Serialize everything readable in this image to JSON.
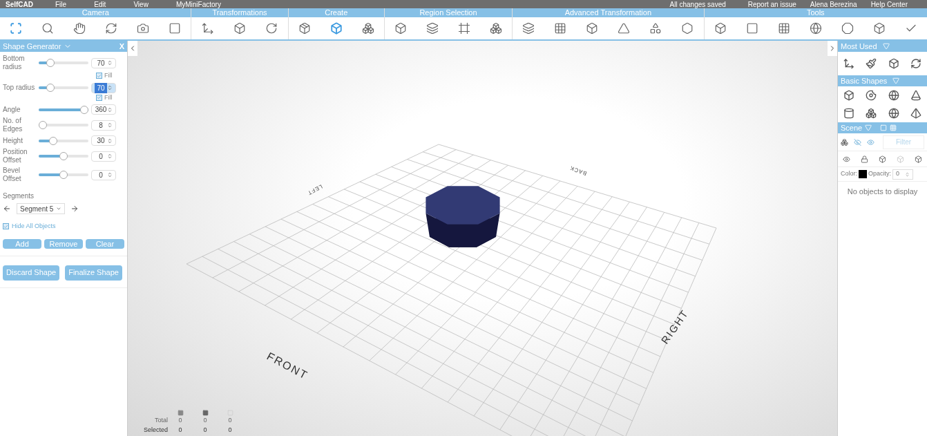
{
  "menu_bar": {
    "logo": "SelfCAD",
    "menus": [
      "File",
      "Edit",
      "View",
      "MyMiniFactory"
    ],
    "status": "All changes saved",
    "links": [
      "Report an issue",
      "Alena Berezina",
      "Help Center"
    ]
  },
  "toolbar": {
    "groups": [
      {
        "label": "Camera",
        "tools": [
          {
            "selected": true
          },
          {
            "selected": false
          },
          {
            "selected": false
          },
          {
            "selected": false
          },
          {
            "selected": false
          },
          {
            "selected": false
          }
        ]
      },
      {
        "label": "Transformations",
        "tools": [
          {
            "selected": false
          },
          {
            "selected": false
          },
          {
            "selected": false
          }
        ]
      },
      {
        "label": "Create",
        "tools": [
          {
            "selected": false
          },
          {
            "selected": true
          },
          {
            "selected": false
          }
        ]
      },
      {
        "label": "Region Selection",
        "tools": [
          {
            "selected": false
          },
          {
            "selected": false
          },
          {
            "selected": false
          },
          {
            "selected": false
          }
        ]
      },
      {
        "label": "Advanced Transformation",
        "tools": [
          {
            "selected": false
          },
          {
            "selected": false
          },
          {
            "selected": false
          },
          {
            "selected": false
          },
          {
            "selected": false
          },
          {
            "selected": false
          }
        ]
      },
      {
        "label": "Tools",
        "tools": [
          {
            "selected": false
          },
          {
            "selected": false
          },
          {
            "selected": false
          },
          {
            "selected": false
          },
          {
            "selected": false
          },
          {
            "selected": false
          },
          {
            "selected": false
          }
        ]
      }
    ]
  },
  "shape_generator": {
    "title": "Shape Generator",
    "close": "X",
    "params": [
      {
        "label": "Bottom radius",
        "level": 0.18,
        "value": "70",
        "fill": {
          "label": "Fill",
          "checked": true
        },
        "highlighted": false
      },
      {
        "label": "Top radius",
        "level": 0.18,
        "value": "70",
        "fill": {
          "label": "Fill",
          "checked": true
        },
        "highlighted": true
      },
      {
        "label": "Angle",
        "level": 1.0,
        "value": "360",
        "highlighted": false
      },
      {
        "label": "No. of Edges",
        "level": 0.0,
        "value": "8",
        "highlighted": false
      },
      {
        "label": "Height",
        "level": 0.25,
        "value": "30",
        "highlighted": false
      },
      {
        "label": "Position Offset",
        "level": 0.5,
        "value": "0",
        "highlighted": false
      },
      {
        "label": "Bevel Offset",
        "level": 0.5,
        "value": "0",
        "highlighted": false
      }
    ],
    "segments": {
      "label": "Segments",
      "value": "Segment 5"
    },
    "hide_all": {
      "label": "Hide All Objects",
      "checked": true
    },
    "buttons": [
      "Add",
      "Remove",
      "Clear"
    ],
    "actions": [
      "Discard Shape",
      "Finalize Shape"
    ]
  },
  "viewport": {
    "labels": {
      "front": "FRONT",
      "right": "RIGHT",
      "left": "LEFT",
      "back": "BACK"
    },
    "stats": {
      "rows": [
        {
          "label": "Total",
          "values": [
            "0",
            "0",
            "0"
          ]
        },
        {
          "label": "Selected",
          "values": [
            "0",
            "0",
            "0"
          ]
        }
      ]
    }
  },
  "right_panel": {
    "most_used": {
      "title": "Most Used"
    },
    "basic_shapes": {
      "title": "Basic Shapes"
    },
    "scene": {
      "title": "Scene",
      "filter_placeholder": "Filter",
      "color_label": "Color:",
      "color": "#000000",
      "opacity_label": "Opacity:",
      "opacity": "0",
      "empty": "No objects to display"
    }
  }
}
